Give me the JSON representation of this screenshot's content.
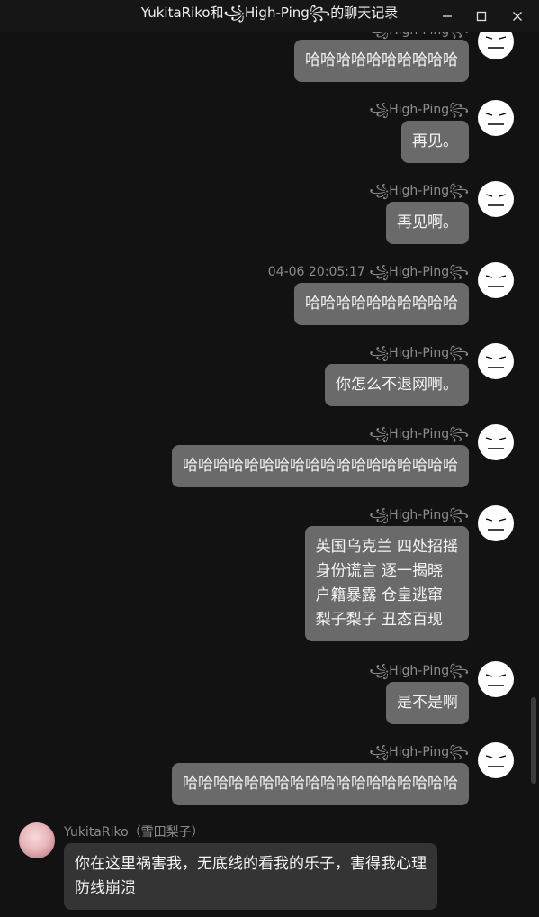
{
  "window": {
    "title": "YukitaRiko和꧁High-Ping꧂的聊天记录",
    "minimize_icon": "minimize-icon",
    "maximize_icon": "maximize-icon",
    "close_icon": "close-icon"
  },
  "messages": [
    {
      "sender": "꧁High-Ping꧂",
      "text": "哈哈哈哈哈哈哈哈哈哈"
    },
    {
      "sender": "꧁High-Ping꧂",
      "text": "再见。"
    },
    {
      "sender": "꧁High-Ping꧂",
      "text": "再见啊。"
    },
    {
      "timestamp": "04-06 20:05:17",
      "sender": "꧁High-Ping꧂",
      "text": "哈哈哈哈哈哈哈哈哈哈"
    },
    {
      "sender": "꧁High-Ping꧂",
      "text": "你怎么不退网啊。"
    },
    {
      "sender": "꧁High-Ping꧂",
      "text": "哈哈哈哈哈哈哈哈哈哈哈哈哈哈哈哈哈哈"
    },
    {
      "sender": "꧁High-Ping꧂",
      "lines": [
        "英国乌克兰 四处招摇",
        "身份谎言 逐一揭晓",
        "户籍暴露 仓皇逃窜",
        "梨子梨子 丑态百现"
      ]
    },
    {
      "sender": "꧁High-Ping꧂",
      "text": "是不是啊"
    },
    {
      "sender": "꧁High-Ping꧂",
      "text": "哈哈哈哈哈哈哈哈哈哈哈哈哈哈哈哈哈哈"
    },
    {
      "sender": "YukitaRiko（雪田梨子）",
      "text": "你在这里祸害我，无底线的看我的乐子，害得我心理防线崩溃"
    }
  ]
}
